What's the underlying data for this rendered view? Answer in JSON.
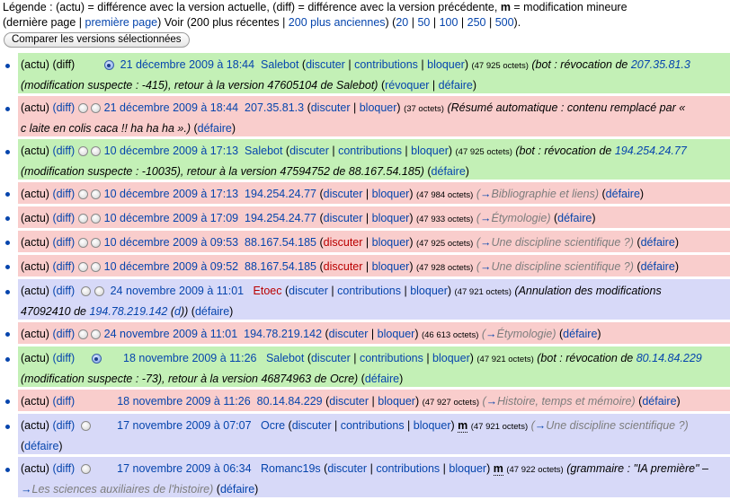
{
  "legend": {
    "prefix": "Légende : (actu) = différence avec la version actuelle, (diff) = différence avec la version précédente, ",
    "minor_key": "m",
    "minor_text": " = modification mineure",
    "line2_start": "(dernière page | ",
    "first_page": "première page",
    "line2_mid": ") Voir (200 plus récentes | ",
    "older": "200 plus anciennes",
    "line2_tail": ") (",
    "limits": [
      "20",
      "50",
      "100",
      "250",
      "500"
    ],
    "sep": " | ",
    "close": ")."
  },
  "compare_button": "Comparer les versions sélectionnées",
  "labels": {
    "actu": "(actu)",
    "diff": "(diff)",
    "discuter": "discuter",
    "contributions": "contributions",
    "bloquer": "bloquer",
    "revoquer": "révoquer",
    "defaire": "défaire",
    "arrow": "→"
  },
  "rows": [
    {
      "date": "21 décembre 2009 à 18:44",
      "user": "Salebot",
      "bytes": "(47 925 octets)",
      "comment_a": "(bot : révocation de ",
      "comment_link": "207.35.81.3",
      "comment_b": "(modification suspecte : -415), retour à la version 47605104 de Salebot)"
    },
    {
      "date": "21 décembre 2009 à 18:44",
      "user": "207.35.81.3",
      "bytes": "(37 octets)",
      "comment_a": "(Résumé automatique : contenu remplacé par « c laite en colis caca !! ha ha ha ».)"
    },
    {
      "date": "10 décembre 2009 à 17:13",
      "user": "Salebot",
      "bytes": "(47 925 octets)",
      "comment_a": "(bot : révocation de ",
      "comment_link": "194.254.24.77",
      "comment_b": "(modification suspecte : -10035), retour à la version 47594752 de 88.167.54.185)"
    },
    {
      "date": "10 décembre 2009 à 17:13",
      "user": "194.254.24.77",
      "bytes": "(47 984 octets)",
      "section": "Bibliographie et liens"
    },
    {
      "date": "10 décembre 2009 à 17:09",
      "user": "194.254.24.77",
      "bytes": "(47 933 octets)",
      "section": "Étymologie"
    },
    {
      "date": "10 décembre 2009 à 09:53",
      "user": "88.167.54.185",
      "bytes": "(47 925 octets)",
      "section": "Une discipline scientifique ?"
    },
    {
      "date": "10 décembre 2009 à 09:52",
      "user": "88.167.54.185",
      "bytes": "(47 928 octets)",
      "section": "Une discipline scientifique ?"
    },
    {
      "date": "24 novembre 2009 à 11:01",
      "user": "Etoec",
      "bytes": "(47 921 octets)",
      "comment_a": "(Annulation des modifications ",
      "comment_b1": "47092410 de ",
      "comment_link": "194.78.219.142",
      "comment_d": "d",
      "comment_close": ")"
    },
    {
      "date": "24 novembre 2009 à 11:01",
      "user": "194.78.219.142",
      "bytes": "(46 613 octets)",
      "section": "Étymologie"
    },
    {
      "date": "18 novembre 2009 à 11:26",
      "user": "Salebot",
      "bytes": "(47 921 octets)",
      "comment_a": "(bot : révocation de ",
      "comment_link": "80.14.84.229",
      "comment_b": "(modification suspecte : -73), retour à la version 46874963 de Ocre)"
    },
    {
      "date": "18 novembre 2009 à 11:26",
      "user": "80.14.84.229",
      "bytes": "(47 927 octets)",
      "section": "Histoire, temps et mémoire"
    },
    {
      "date": "17 novembre 2009 à 07:07",
      "user": "Ocre",
      "bytes": "(47 921 octets)",
      "section": "Une discipline scientifique ?"
    },
    {
      "date": "17 novembre 2009 à 06:34",
      "user": "Romanc19s",
      "bytes": "(47 922 octets)",
      "comment_a": "(grammaire : \"IA première\" – ",
      "section": "Les sciences auxiliaires de l'histoire",
      "comment_close": ")"
    }
  ]
}
